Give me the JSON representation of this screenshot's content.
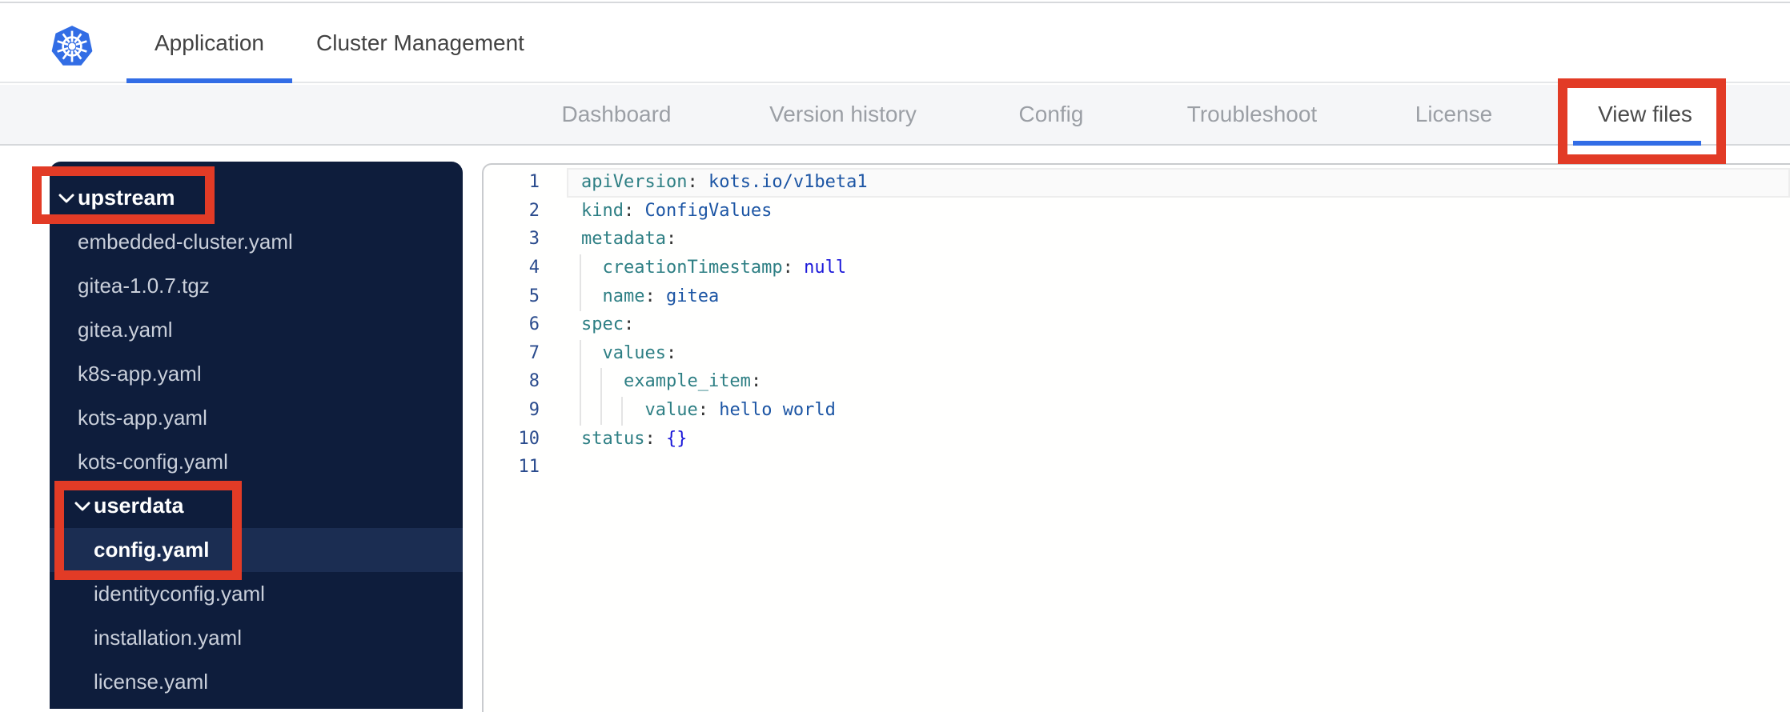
{
  "topnav": {
    "logo": "kubernetes-logo",
    "tabs": [
      {
        "label": "Application",
        "active": true
      },
      {
        "label": "Cluster Management",
        "active": false
      }
    ]
  },
  "subnav": {
    "tabs": [
      {
        "label": "Dashboard",
        "active": false
      },
      {
        "label": "Version history",
        "active": false
      },
      {
        "label": "Config",
        "active": false
      },
      {
        "label": "Troubleshoot",
        "active": false
      },
      {
        "label": "License",
        "active": false
      },
      {
        "label": "View files",
        "active": true
      }
    ]
  },
  "file_tree": {
    "items": [
      {
        "label": "upstream",
        "type": "folder",
        "depth": 0,
        "expanded": true
      },
      {
        "label": "embedded-cluster.yaml",
        "type": "file",
        "depth": 1
      },
      {
        "label": "gitea-1.0.7.tgz",
        "type": "file",
        "depth": 1
      },
      {
        "label": "gitea.yaml",
        "type": "file",
        "depth": 1
      },
      {
        "label": "k8s-app.yaml",
        "type": "file",
        "depth": 1
      },
      {
        "label": "kots-app.yaml",
        "type": "file",
        "depth": 1
      },
      {
        "label": "kots-config.yaml",
        "type": "file",
        "depth": 1
      },
      {
        "label": "userdata",
        "type": "folder",
        "depth": 1,
        "expanded": true
      },
      {
        "label": "config.yaml",
        "type": "file",
        "depth": 2,
        "selected": true
      },
      {
        "label": "identityconfig.yaml",
        "type": "file",
        "depth": 2
      },
      {
        "label": "installation.yaml",
        "type": "file",
        "depth": 2
      },
      {
        "label": "license.yaml",
        "type": "file",
        "depth": 2
      }
    ]
  },
  "editor": {
    "file": "config.yaml",
    "lines": [
      {
        "num": "1",
        "tokens": [
          [
            "key",
            "apiVersion"
          ],
          [
            "punc",
            ": "
          ],
          [
            "val",
            "kots.io/v1beta1"
          ]
        ],
        "current": true
      },
      {
        "num": "2",
        "tokens": [
          [
            "key",
            "kind"
          ],
          [
            "punc",
            ": "
          ],
          [
            "val",
            "ConfigValues"
          ]
        ]
      },
      {
        "num": "3",
        "tokens": [
          [
            "key",
            "metadata"
          ],
          [
            "punc",
            ":"
          ]
        ]
      },
      {
        "num": "4",
        "tokens": [
          [
            "punc",
            "  "
          ],
          [
            "key",
            "creationTimestamp"
          ],
          [
            "punc",
            ": "
          ],
          [
            "kw",
            "null"
          ]
        ]
      },
      {
        "num": "5",
        "tokens": [
          [
            "punc",
            "  "
          ],
          [
            "key",
            "name"
          ],
          [
            "punc",
            ": "
          ],
          [
            "val",
            "gitea"
          ]
        ]
      },
      {
        "num": "6",
        "tokens": [
          [
            "key",
            "spec"
          ],
          [
            "punc",
            ":"
          ]
        ]
      },
      {
        "num": "7",
        "tokens": [
          [
            "punc",
            "  "
          ],
          [
            "key",
            "values"
          ],
          [
            "punc",
            ":"
          ]
        ]
      },
      {
        "num": "8",
        "tokens": [
          [
            "punc",
            "    "
          ],
          [
            "key",
            "example_item"
          ],
          [
            "punc",
            ":"
          ]
        ]
      },
      {
        "num": "9",
        "tokens": [
          [
            "punc",
            "      "
          ],
          [
            "key",
            "value"
          ],
          [
            "punc",
            ": "
          ],
          [
            "val",
            "hello world"
          ]
        ]
      },
      {
        "num": "10",
        "tokens": [
          [
            "key",
            "status"
          ],
          [
            "punc",
            ": "
          ],
          [
            "kw",
            "{}"
          ]
        ]
      },
      {
        "num": "11",
        "tokens": []
      }
    ]
  },
  "annotations": {
    "color": "#e23b26",
    "boxes": [
      "view-files-tab",
      "upstream-folder",
      "userdata-and-config-yaml"
    ]
  },
  "colors": {
    "brand_blue": "#326de6",
    "sidebar_bg": "#0e1d3c",
    "sidebar_selected_bg": "#1b2d52",
    "subnav_bg": "#f5f6f8",
    "yaml_key": "#2e7f84",
    "yaml_value": "#1c55a4",
    "yaml_keyword": "#1a17d9",
    "line_number": "#2a4b8d"
  }
}
